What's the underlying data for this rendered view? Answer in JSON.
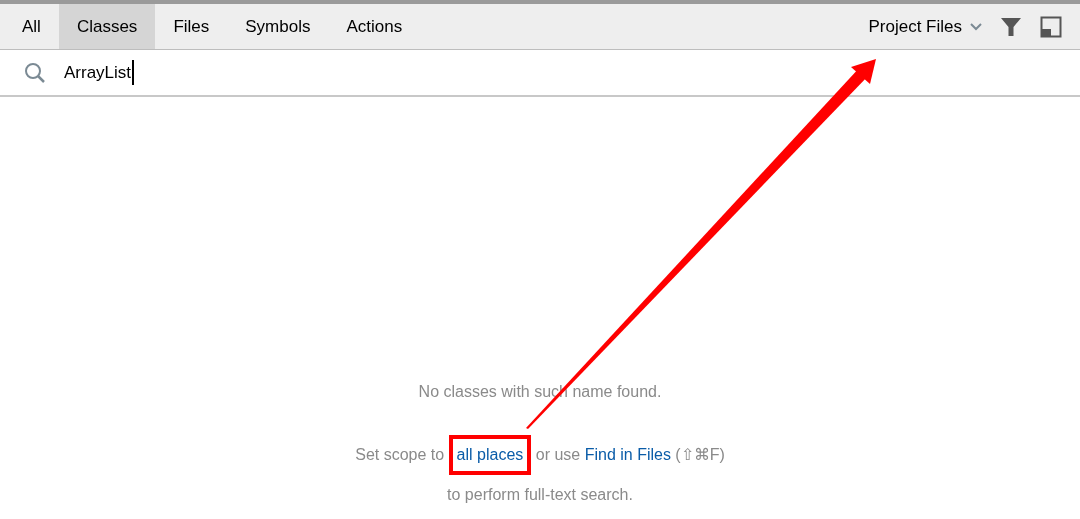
{
  "tabs": [
    {
      "label": "All",
      "selected": false
    },
    {
      "label": "Classes",
      "selected": true
    },
    {
      "label": "Files",
      "selected": false
    },
    {
      "label": "Symbols",
      "selected": false
    },
    {
      "label": "Actions",
      "selected": false
    }
  ],
  "scope": {
    "label": "Project Files"
  },
  "search": {
    "value": "ArrayList"
  },
  "empty_state": {
    "message": "No classes with such name found.",
    "hint_before": "Set scope to ",
    "hint_link_1": "all places",
    "hint_middle": " or use ",
    "hint_link_2": "Find in Files",
    "hint_after": " (⇧⌘F)",
    "hint_line_2": "to perform full-text search."
  },
  "annotations": {
    "highlight_box": true,
    "arrow": true
  }
}
